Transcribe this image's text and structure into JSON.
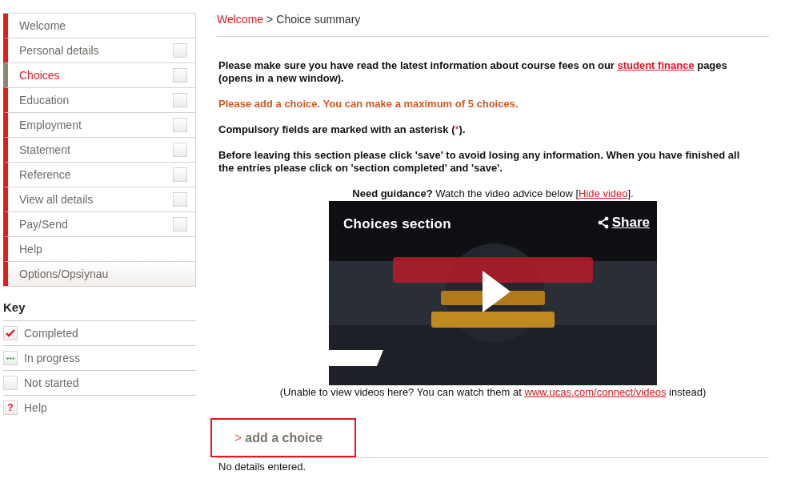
{
  "sidebar": {
    "items": [
      {
        "label": "Welcome",
        "selected": false
      },
      {
        "label": "Personal details",
        "selected": false,
        "checked": false
      },
      {
        "label": "Choices",
        "selected": true,
        "checked": false
      },
      {
        "label": "Education",
        "selected": false,
        "checked": false
      },
      {
        "label": "Employment",
        "selected": false,
        "checked": false
      },
      {
        "label": "Statement",
        "selected": false,
        "checked": false
      },
      {
        "label": "Reference",
        "selected": false,
        "checked": false
      },
      {
        "label": "View all details",
        "selected": false,
        "checked": false
      },
      {
        "label": "Pay/Send",
        "selected": false,
        "checked": false
      },
      {
        "label": "Help",
        "selected": false
      },
      {
        "label": "Options/Opsiynau",
        "selected": false
      }
    ]
  },
  "key": {
    "title": "Key",
    "items": [
      {
        "kind": "completed",
        "label": "Completed"
      },
      {
        "kind": "in_progress",
        "label": "In progress"
      },
      {
        "kind": "not_started",
        "label": "Not started"
      },
      {
        "kind": "help",
        "label": "Help",
        "glyph": "?"
      }
    ]
  },
  "breadcrumb": {
    "link": "Welcome",
    "separator": ">",
    "current": "Choice summary"
  },
  "notices": {
    "fees": {
      "before": "Please make sure you have read the latest information about course fees on our ",
      "link": "student finance",
      "after": " pages (opens in a new window)."
    },
    "warning": "Please add a choice. You can make a maximum of 5 choices.",
    "compulsory": {
      "before": "Compulsory fields are marked with an asterisk (",
      "mark": "*",
      "after": ")."
    },
    "save": "Before leaving this section please click 'save' to avoid losing any information. When you have finished all the entries please click on 'section completed' and 'save'."
  },
  "video": {
    "guidance_label": "Need guidance?",
    "guidance_text": " Watch the video advice below [",
    "hide_link": "Hide video",
    "guidance_end": "].",
    "title": "Choices section",
    "share": "Share",
    "fallback_before": "(Unable to view videos here? You can watch them at ",
    "fallback_link": "www.ucas.com/connect/videos",
    "fallback_after": " instead)"
  },
  "add_choice": {
    "chevron": ">",
    "label": "add a choice"
  },
  "empty_message": "No details entered."
}
